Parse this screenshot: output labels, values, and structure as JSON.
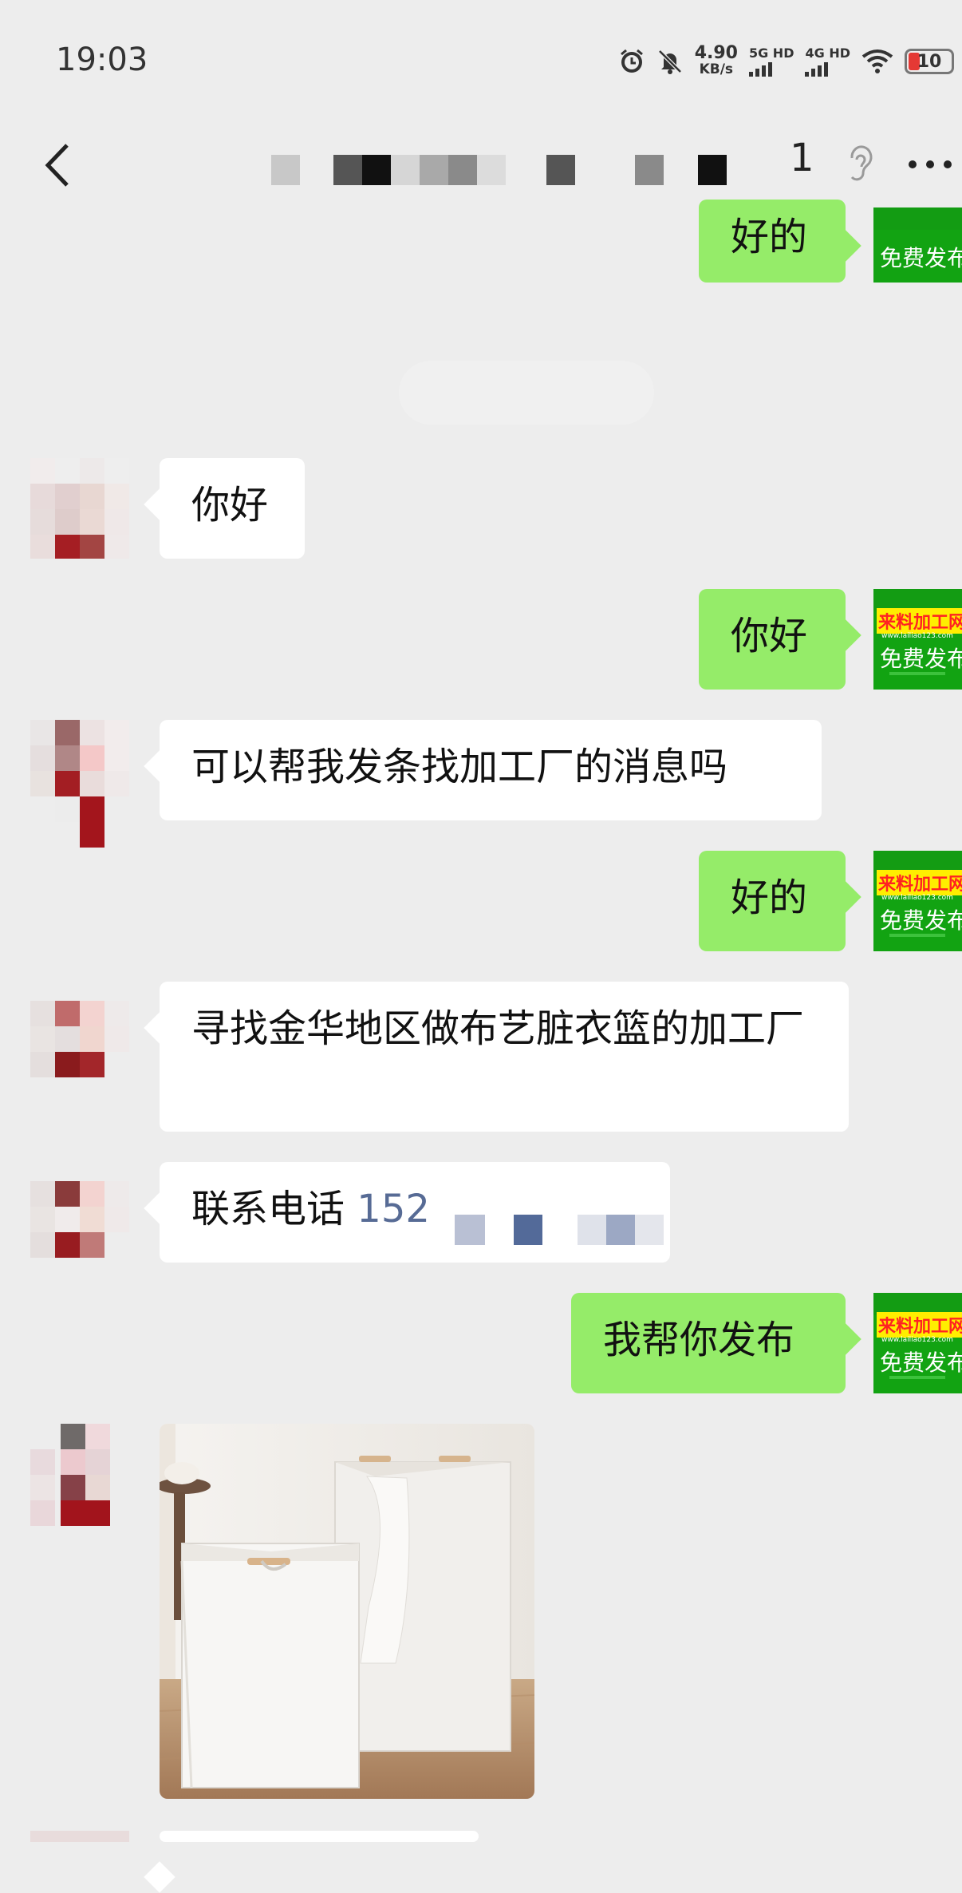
{
  "status_bar": {
    "time": "19:03",
    "net_speed_value": "4.90",
    "net_speed_unit": "KB/s",
    "sim1_label": "5G HD",
    "sim2_label": "4G HD",
    "battery_level": "10",
    "icons": [
      "alarm-icon",
      "mute-icon",
      "signal-icon",
      "wifi-icon",
      "battery-icon"
    ]
  },
  "header": {
    "title_visible_tail": "1"
  },
  "messages": [
    {
      "side": "right",
      "text": "好的"
    },
    {
      "side": "left",
      "text": "你好"
    },
    {
      "side": "right",
      "text": "你好"
    },
    {
      "side": "left",
      "text": "可以帮我发条找加工厂的消息吗"
    },
    {
      "side": "right",
      "text": "好的"
    },
    {
      "side": "left",
      "text": "寻找金华地区做布艺脏衣篮的加工厂"
    },
    {
      "side": "left",
      "text": "联系电话",
      "phone_partial": "152"
    },
    {
      "side": "right",
      "text": "我帮你发布"
    },
    {
      "side": "left",
      "type": "image",
      "image_desc": "laundry-baskets-photo"
    }
  ],
  "my_avatar": {
    "brand": "来料加工网",
    "url": "www.lailiao123.com",
    "tagline": "免费发布"
  },
  "colors": {
    "background": "#ededed",
    "my_bubble": "#95ec69",
    "their_bubble": "#ffffff",
    "link": "#576b95"
  }
}
